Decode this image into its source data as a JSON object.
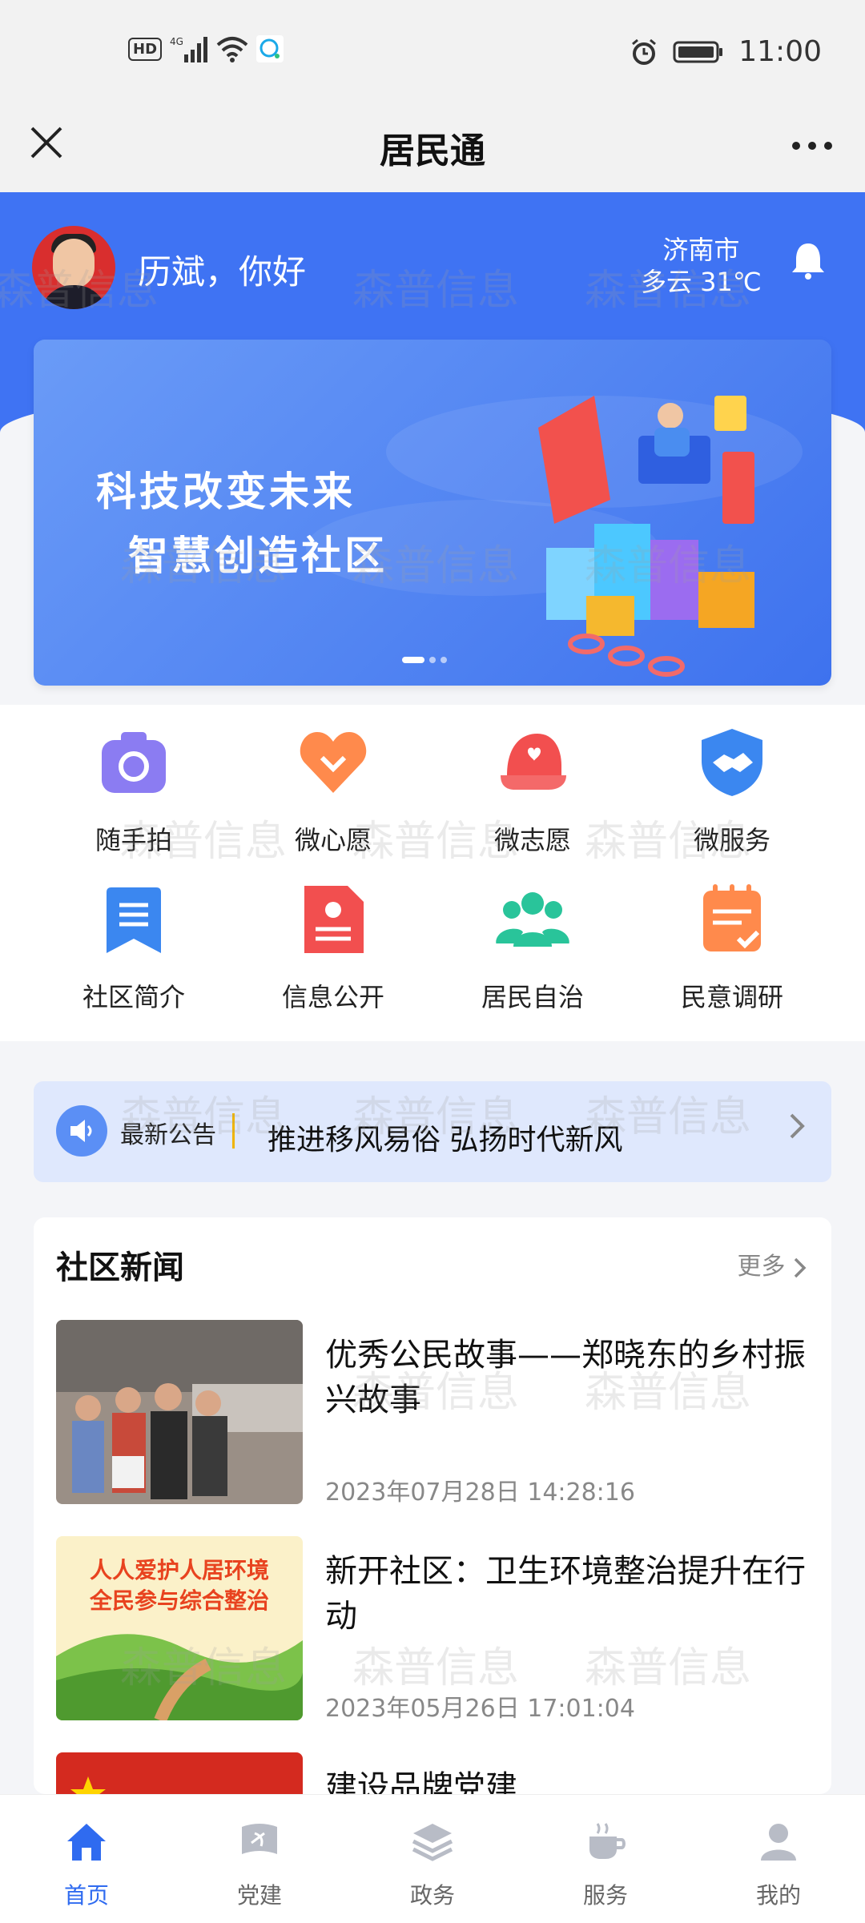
{
  "status_bar": {
    "time": "11:00",
    "left_icons": [
      "hd-icon",
      "signal-4g-icon",
      "wifi-icon",
      "message-icon"
    ],
    "right_icons": [
      "alarm-icon",
      "battery-icon"
    ]
  },
  "title_bar": {
    "title": "居民通"
  },
  "header": {
    "greeting": "历斌，你好",
    "city": "济南市",
    "weather": "多云 31℃"
  },
  "banner": {
    "line1": "科技改变未来",
    "line2": "智慧创造社区"
  },
  "grid": [
    {
      "label": "随手拍",
      "icon": "camera-icon",
      "color": "#8b7cf2"
    },
    {
      "label": "微心愿",
      "icon": "heart-icon",
      "color": "#ff8a4c"
    },
    {
      "label": "微志愿",
      "icon": "cap-icon",
      "color": "#f24f4f"
    },
    {
      "label": "微服务",
      "icon": "handshake-shield-icon",
      "color": "#3b87f0"
    },
    {
      "label": "社区简介",
      "icon": "bookmark-icon",
      "color": "#3b87f0"
    },
    {
      "label": "信息公开",
      "icon": "document-icon",
      "color": "#f24f4f"
    },
    {
      "label": "居民自治",
      "icon": "group-icon",
      "color": "#29c49a"
    },
    {
      "label": "民意调研",
      "icon": "survey-icon",
      "color": "#ff8a4c"
    }
  ],
  "notice": {
    "tag": "最新公告",
    "text": "推进移风易俗 弘扬时代新风"
  },
  "news": {
    "title": "社区新闻",
    "more": "更多",
    "items": [
      {
        "title": "优秀公民故事——郑晓东的乡村振兴故事",
        "date": "2023年07月28日 14:28:16"
      },
      {
        "title": "新开社区：卫生环境整治提升在行动",
        "date": "2023年05月26日 17:01:04",
        "image_text": "人人爱护人居环境 全民参与综合整治"
      },
      {
        "title": "建设品牌党建",
        "date": ""
      }
    ]
  },
  "tabs": [
    {
      "label": "首页",
      "icon": "home-icon",
      "active": true
    },
    {
      "label": "党建",
      "icon": "party-flag-icon",
      "active": false
    },
    {
      "label": "政务",
      "icon": "layers-icon",
      "active": false
    },
    {
      "label": "服务",
      "icon": "coffee-icon",
      "active": false
    },
    {
      "label": "我的",
      "icon": "user-icon",
      "active": false
    }
  ],
  "watermark": "森普信息",
  "colors": {
    "primary": "#2f6bf0",
    "hero": "#3f73f3"
  }
}
